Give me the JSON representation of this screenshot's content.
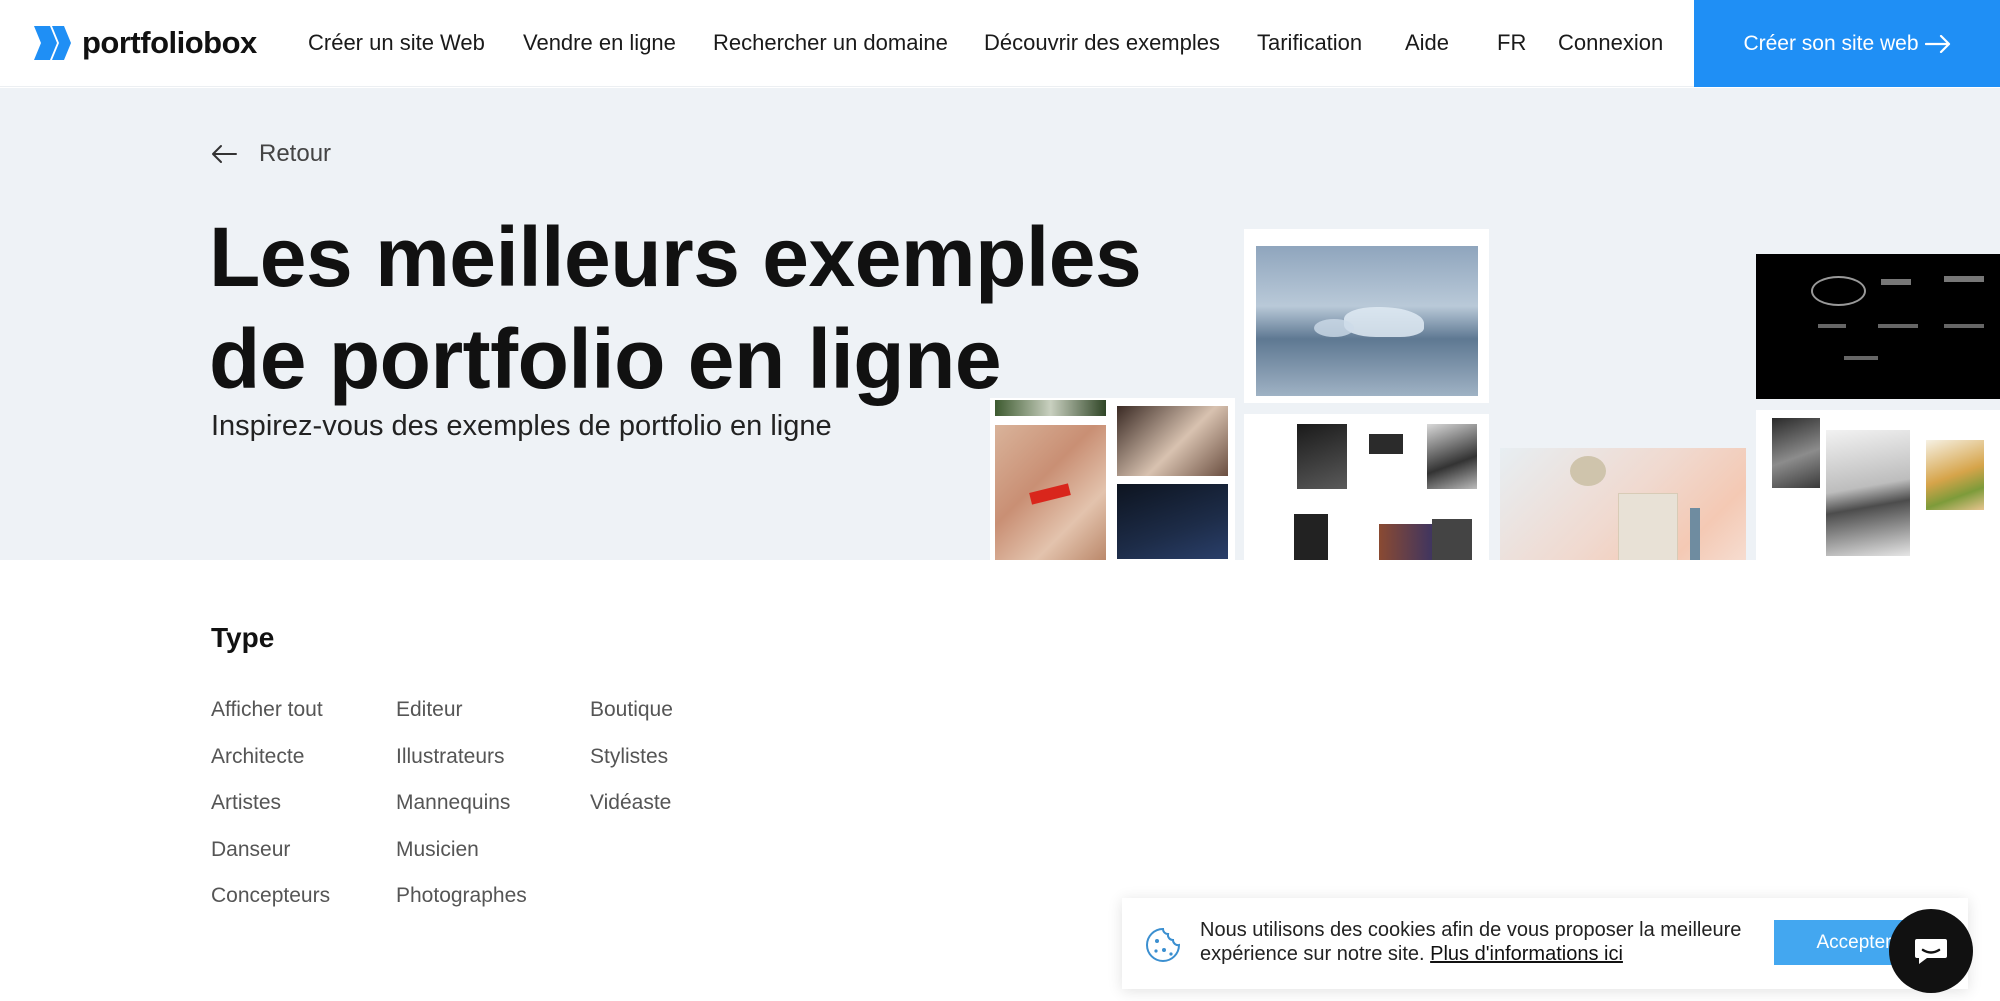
{
  "brand": {
    "name": "portfoliobox",
    "accent": "#1f8ff5"
  },
  "nav": {
    "links": [
      "Créer un site Web",
      "Vendre en ligne",
      "Rechercher un domaine",
      "Découvrir des exemples",
      "Tarification",
      "Aide",
      "FR",
      "Connexion"
    ],
    "cta": "Créer son site web"
  },
  "hero": {
    "back": "Retour",
    "title": "Les meilleurs exemples de portfolio en ligne",
    "subtitle": "Inspirez-vous des exemples de portfolio en ligne"
  },
  "filters": {
    "heading": "Type",
    "columns": [
      [
        "Afficher tout",
        "Architecte",
        "Artistes",
        "Danseur",
        "Concepteurs"
      ],
      [
        "Editeur",
        "Illustrateurs",
        "Mannequins",
        "Musicien",
        "Photographes"
      ],
      [
        "Boutique",
        "Stylistes",
        "Vidéaste"
      ]
    ]
  },
  "cookie": {
    "text": "Nous utilisons des cookies afin de vous proposer la meilleure expérience sur notre site.",
    "link": "Plus d'informations ici",
    "accept": "Accepter"
  },
  "icons": {
    "logo": "portfoliobox-logo-icon",
    "back": "arrow-left-icon",
    "cta": "arrow-right-icon",
    "cookie": "cookie-icon",
    "chat": "chat-icon"
  }
}
